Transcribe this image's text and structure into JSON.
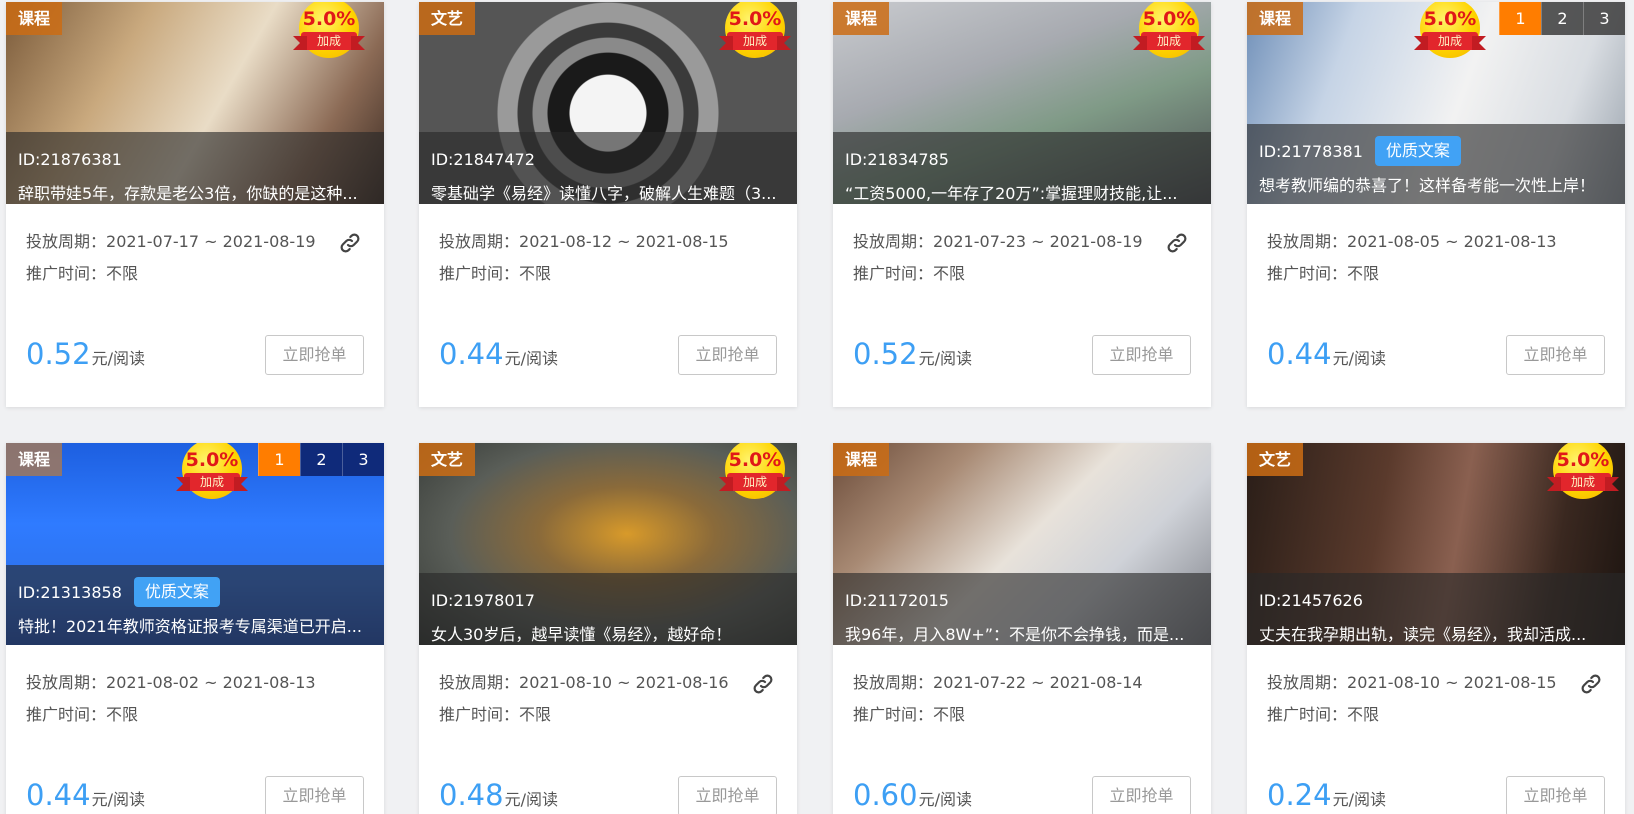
{
  "bonus": {
    "percent": "5.0%",
    "label": "加成"
  },
  "labels": {
    "period_prefix": "投放周期：",
    "promo_prefix": "推广时间：",
    "unit": "元/阅读",
    "grab_button": "立即抢单"
  },
  "quality_badge": "优质文案",
  "pager": [
    "1",
    "2",
    "3"
  ],
  "colors": {
    "accent_blue": "#3d9ff4",
    "tag_orange": "#cb6c14",
    "badge_blue": "#41a2f5",
    "pager_active": "#ff7d00"
  },
  "cards": [
    {
      "tag": "课程",
      "id": "ID:21876381",
      "title": "辞职带娃5年，存款是老公3倍，你缺的是这种...",
      "period": "2021-07-17 ~ 2021-08-19",
      "promo": "不限",
      "price": "0.52",
      "has_link": true,
      "has_badge": false,
      "pager": "none"
    },
    {
      "tag": "文艺",
      "id": "ID:21847472",
      "title": "零基础学《易经》读懂八字，破解人生难题（3...",
      "period": "2021-08-12 ~ 2021-08-15",
      "promo": "不限",
      "price": "0.44",
      "has_link": false,
      "has_badge": false,
      "pager": "none"
    },
    {
      "tag": "课程",
      "id": "ID:21834785",
      "title": "“工资5000,一年存了20万”:掌握理财技能,让...",
      "period": "2021-07-23 ~ 2021-08-19",
      "promo": "不限",
      "price": "0.52",
      "has_link": true,
      "has_badge": false,
      "pager": "none"
    },
    {
      "tag": "课程",
      "id": "ID:21778381",
      "title": "想考教师编的恭喜了！这样备考能一次性上岸！",
      "period": "2021-08-05 ~ 2021-08-13",
      "promo": "不限",
      "price": "0.44",
      "has_link": false,
      "has_badge": true,
      "pager": "gray"
    },
    {
      "tag": "课程",
      "id": "ID:21313858",
      "title": "特批！2021年教师资格证报考专属渠道已开启...",
      "period": "2021-08-02 ~ 2021-08-13",
      "promo": "不限",
      "price": "0.44",
      "has_link": false,
      "has_badge": true,
      "pager": "blue"
    },
    {
      "tag": "文艺",
      "id": "ID:21978017",
      "title": "女人30岁后，越早读懂《易经》，越好命！",
      "period": "2021-08-10 ~ 2021-08-16",
      "promo": "不限",
      "price": "0.48",
      "has_link": true,
      "has_badge": false,
      "pager": "none"
    },
    {
      "tag": "课程",
      "id": "ID:21172015",
      "title": "我96年，月入8W+”：不是你不会挣钱，而是...",
      "period": "2021-07-22 ~ 2021-08-14",
      "promo": "不限",
      "price": "0.60",
      "has_link": false,
      "has_badge": false,
      "pager": "none"
    },
    {
      "tag": "文艺",
      "id": "ID:21457626",
      "title": "丈夫在我孕期出轨，读完《易经》，我却活成...",
      "period": "2021-08-10 ~ 2021-08-15",
      "promo": "不限",
      "price": "0.24",
      "has_link": true,
      "has_badge": false,
      "pager": "none"
    }
  ]
}
